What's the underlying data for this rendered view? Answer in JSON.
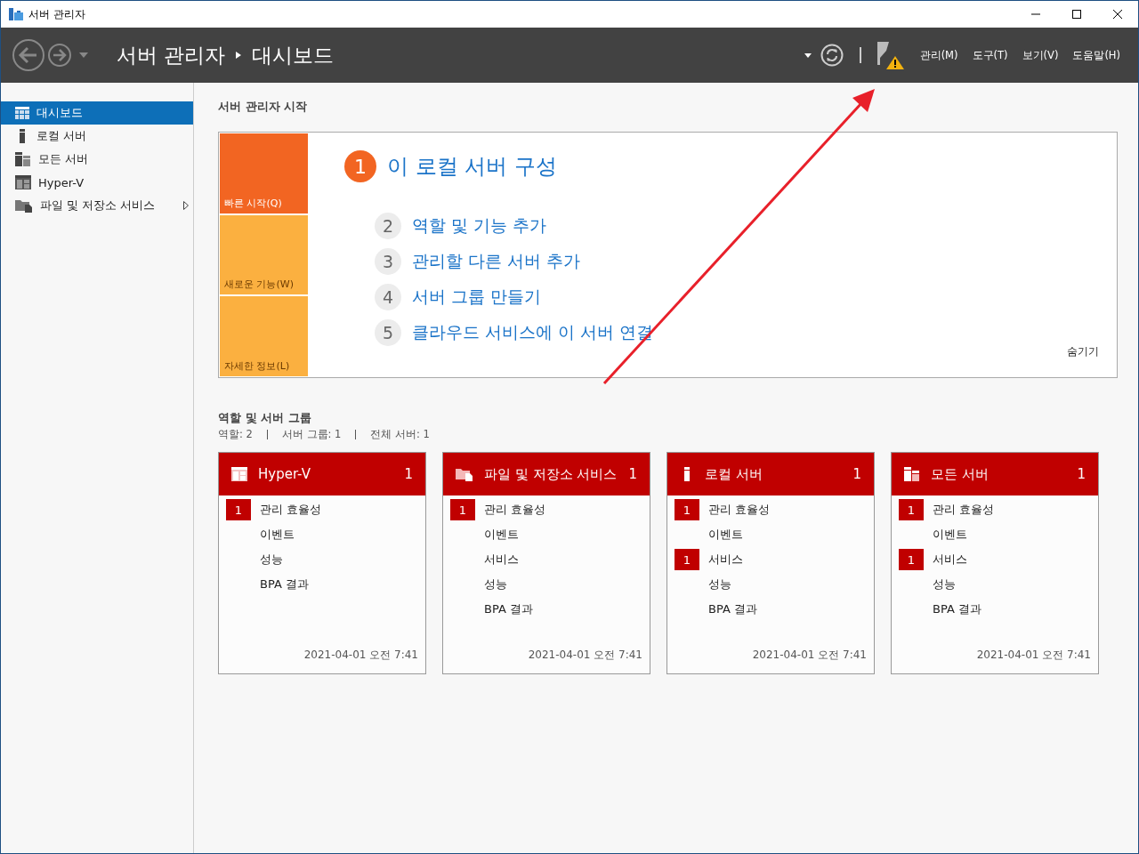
{
  "window": {
    "title": "서버 관리자"
  },
  "header": {
    "breadcrumb_root": "서버 관리자",
    "breadcrumb_current": "대시보드",
    "menus": [
      "관리(M)",
      "도구(T)",
      "보기(V)",
      "도움말(H)"
    ],
    "notification_warning": true
  },
  "sidebar": {
    "items": [
      {
        "label": "대시보드",
        "kind": "dashboard",
        "selected": true,
        "expandable": false
      },
      {
        "label": "로컬 서버",
        "kind": "server",
        "selected": false,
        "expandable": false
      },
      {
        "label": "모든 서버",
        "kind": "servers",
        "selected": false,
        "expandable": false
      },
      {
        "label": "Hyper-V",
        "kind": "hyperv",
        "selected": false,
        "expandable": false
      },
      {
        "label": "파일 및 저장소 서비스",
        "kind": "files",
        "selected": false,
        "expandable": true
      }
    ]
  },
  "welcome": {
    "title": "서버 관리자 시작",
    "tiles": [
      {
        "label": "빠른 시작(Q)",
        "selected": true
      },
      {
        "label": "새로운 기능(W)",
        "selected": false
      },
      {
        "label": "자세한 정보(L)",
        "selected": false
      }
    ],
    "steps": [
      {
        "number": "1",
        "label": "이 로컬 서버 구성",
        "current": true
      },
      {
        "number": "2",
        "label": "역할 및 기능 추가",
        "current": false
      },
      {
        "number": "3",
        "label": "관리할 다른 서버 추가",
        "current": false
      },
      {
        "number": "4",
        "label": "서버 그룹 만들기",
        "current": false
      },
      {
        "number": "5",
        "label": "클라우드 서비스에 이 서버 연결",
        "current": false
      }
    ],
    "hide_link": "숨기기"
  },
  "groups": {
    "title": "역할 및 서버 그룹",
    "summary": [
      "역할: 2",
      "서버 그룹: 1",
      "전체 서버: 1"
    ],
    "tiles": [
      {
        "name": "Hyper-V",
        "kind": "hyperv",
        "count": "1",
        "alert": true,
        "items": [
          {
            "label": "관리 효율성",
            "count": "1"
          },
          {
            "label": "이벤트"
          },
          {
            "label": "성능"
          },
          {
            "label": "BPA 결과"
          }
        ],
        "timestamp": "2021-04-01 오전 7:41"
      },
      {
        "name": "파일 및 저장소 서비스",
        "kind": "files",
        "count": "1",
        "alert": true,
        "items": [
          {
            "label": "관리 효율성",
            "count": "1"
          },
          {
            "label": "이벤트"
          },
          {
            "label": "서비스"
          },
          {
            "label": "성능"
          },
          {
            "label": "BPA 결과"
          }
        ],
        "timestamp": "2021-04-01 오전 7:41"
      },
      {
        "name": "로컬 서버",
        "kind": "server",
        "count": "1",
        "alert": true,
        "items": [
          {
            "label": "관리 효율성",
            "count": "1"
          },
          {
            "label": "이벤트"
          },
          {
            "label": "서비스",
            "count": "1"
          },
          {
            "label": "성능"
          },
          {
            "label": "BPA 결과"
          }
        ],
        "timestamp": "2021-04-01 오전 7:41"
      },
      {
        "name": "모든 서버",
        "kind": "servers",
        "count": "1",
        "alert": true,
        "items": [
          {
            "label": "관리 효율성",
            "count": "1"
          },
          {
            "label": "이벤트"
          },
          {
            "label": "서비스",
            "count": "1"
          },
          {
            "label": "성능"
          },
          {
            "label": "BPA 결과"
          }
        ],
        "timestamp": "2021-04-01 오전 7:41"
      }
    ]
  }
}
